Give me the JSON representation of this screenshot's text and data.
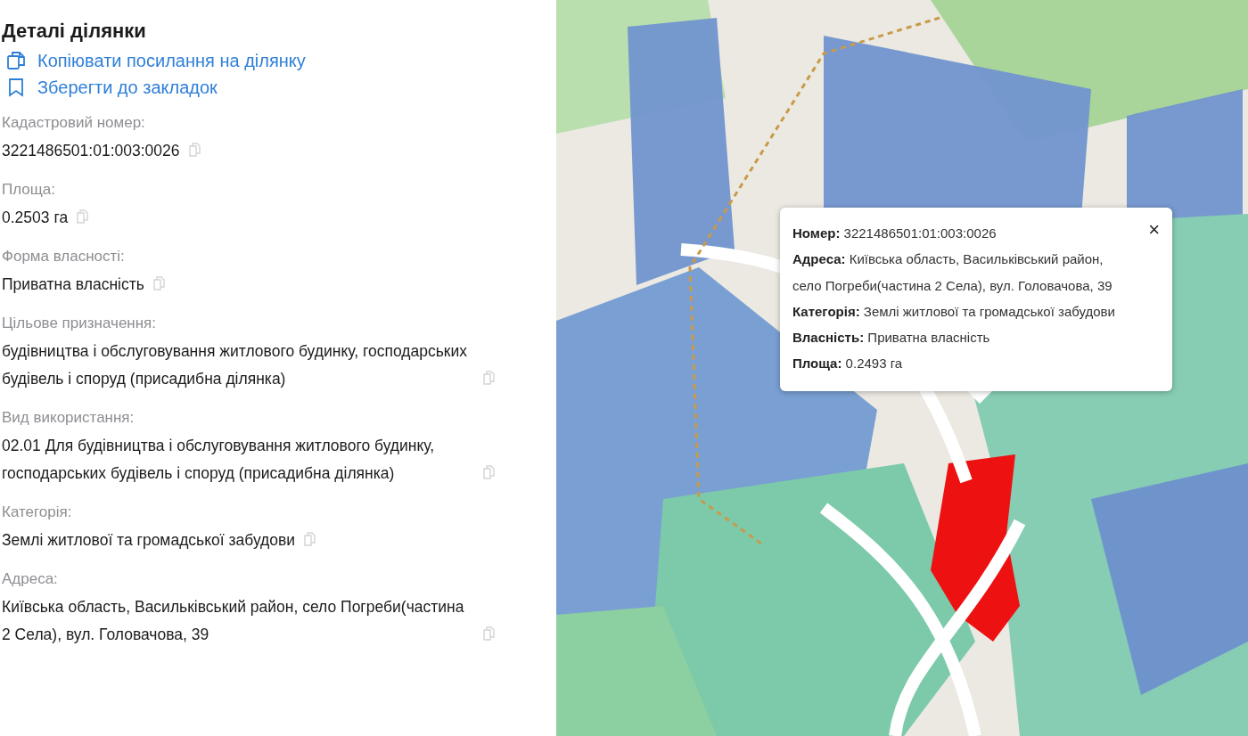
{
  "details": {
    "title": "Деталі ділянки",
    "actions": [
      {
        "kind": "copy",
        "label": "Копіювати посилання на ділянку"
      },
      {
        "kind": "bookmark",
        "label": "Зберегти до закладок"
      }
    ],
    "fields": [
      {
        "label": "Кадастровий номер:",
        "value": "3221486501:01:003:0026"
      },
      {
        "label": "Площа:",
        "value": "0.2503 га"
      },
      {
        "label": "Форма власності:",
        "value": "Приватна власність"
      },
      {
        "label": "Цільове призначення:",
        "value": "будівництва і обслуговування житлового будинку, господарських будівель і споруд (присадибна ділянка)"
      },
      {
        "label": "Вид використання:",
        "value": "02.01 Для будівництва і обслуговування житлового будинку, господарських будівель і споруд (присадибна ділянка)"
      },
      {
        "label": "Категорія:",
        "value": "Землі житлової та громадської забудови"
      },
      {
        "label": "Адреса:",
        "value": "Київська область, Васильківський район, село Погреби(частина 2 Села), вул. Головачова, 39"
      }
    ]
  },
  "map": {
    "kind": "picture",
    "popup": {
      "close": "×",
      "lines": [
        "**Номер:** 3221486501:01:003:0026",
        "**Адреса:** Київська область, Васильківський район, село Погреби(частина 2 Села), вул. Головачова, 39",
        "**Категорія:** Землі житлової та громадської забудови",
        "**Власність:** Приватна власність",
        "**Площа:** 0.2493 га"
      ]
    }
  }
}
